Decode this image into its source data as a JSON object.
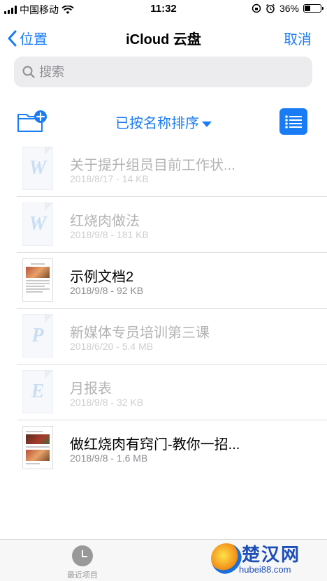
{
  "status_bar": {
    "carrier": "中国移动",
    "time": "11:32",
    "battery": "36%",
    "battery_level": 0.36
  },
  "nav": {
    "back_label": "位置",
    "title": "iCloud 云盘",
    "cancel_label": "取消"
  },
  "search": {
    "placeholder": "搜索"
  },
  "toolbar": {
    "sort_label": "已按名称排序"
  },
  "files": [
    {
      "name": "关于提升组员目前工作状...",
      "meta": "2018/8/17 - 14 KB",
      "icon": "word-doc-icon",
      "letter": "W",
      "enabled": false
    },
    {
      "name": "红烧肉做法",
      "meta": "2018/9/8 - 181 KB",
      "icon": "word-doc-icon",
      "letter": "W",
      "enabled": false
    },
    {
      "name": "示例文档2",
      "meta": "2018/9/8 - 92 KB",
      "icon": "document-thumbnail",
      "letter": "",
      "enabled": true
    },
    {
      "name": "新媒体专员培训第三课",
      "meta": "2018/6/20 - 5.4 MB",
      "icon": "powerpoint-doc-icon",
      "letter": "P",
      "enabled": false
    },
    {
      "name": "月报表",
      "meta": "2018/9/8 - 32 KB",
      "icon": "excel-doc-icon",
      "letter": "E",
      "enabled": false
    },
    {
      "name": "做红烧肉有窍门-教你一招...",
      "meta": "2018/9/8 - 1.6 MB",
      "icon": "document-thumbnail",
      "letter": "",
      "enabled": true
    }
  ],
  "tab_bar": {
    "recent_label": "最近项目"
  },
  "watermark": {
    "title": "楚汉网",
    "url": "hubei88.com"
  },
  "colors": {
    "accent": "#1a7cf5",
    "separator": "#dedede",
    "dimmed_text": "#b3b3b3"
  }
}
